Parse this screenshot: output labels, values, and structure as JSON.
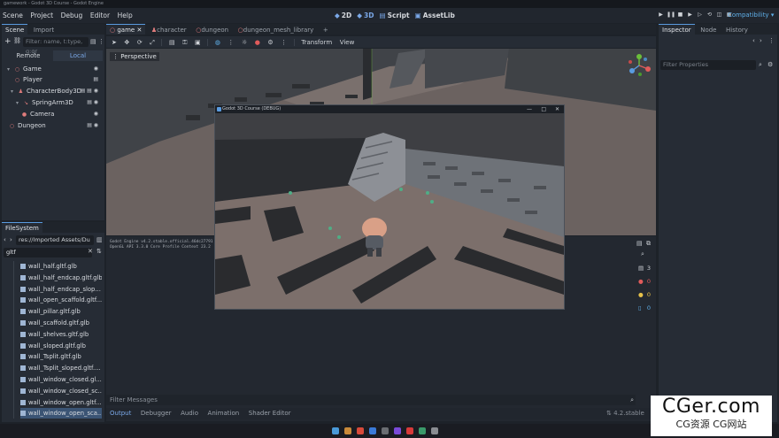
{
  "window_title": "gamework - Godot 3D Course - Godot Engine",
  "menu": [
    "Scene",
    "Project",
    "Debug",
    "Editor",
    "Help"
  ],
  "main_screens": [
    {
      "label": "2D",
      "icon": "2d-icon"
    },
    {
      "label": "3D",
      "icon": "3d-icon"
    },
    {
      "label": "Script",
      "icon": "script-icon"
    },
    {
      "label": "AssetLib",
      "icon": "assetlib-icon"
    }
  ],
  "renderer": "Compatibility",
  "scene_dock": {
    "tabs": [
      "Scene",
      "Import"
    ],
    "filter_placeholder": "Filter: name, t:type, g:gr",
    "remote_label": "Remote",
    "local_label": "Local",
    "nodes": [
      {
        "name": "Game",
        "icon": "node3d-icon",
        "color": "#e07c7c"
      },
      {
        "name": "Player",
        "icon": "node3d-icon",
        "color": "#e07c7c"
      },
      {
        "name": "CharacterBody3D",
        "icon": "characterbody-icon",
        "color": "#e07c7c"
      },
      {
        "name": "SpringArm3D",
        "icon": "springarm-icon",
        "color": "#e07c7c"
      },
      {
        "name": "Camera",
        "icon": "camera-icon",
        "color": "#e07c7c"
      },
      {
        "name": "Dungeon",
        "icon": "node3d-icon",
        "color": "#e07c7c"
      }
    ]
  },
  "filesystem_dock": {
    "tab": "FileSystem",
    "path": "res://Imported Assets/Du",
    "search_value": "gltf",
    "files": [
      "wall_half.gltf.glb",
      "wall_half_endcap.gltf.glb",
      "wall_half_endcap_slop...",
      "wall_open_scaffold.gltf...",
      "wall_pillar.gltf.glb",
      "wall_scaffold.gltf.glb",
      "wall_shelves.gltf.glb",
      "wall_sloped.gltf.glb",
      "wall_Tsplit.gltf.glb",
      "wall_Tsplit_sloped.gltf....",
      "wall_window_closed.gl...",
      "wall_window_closed_sc...",
      "wall_window_open.gltf....",
      "wall_window_open_sca..."
    ]
  },
  "scene_tabs": [
    "game",
    "character",
    "dungeon",
    "dungeon_mesh_library"
  ],
  "viewport": {
    "toolbar_menus": [
      "Transform",
      "View"
    ],
    "perspective_label": "Perspective"
  },
  "game_window": {
    "title": "Godot 3D Course (DEBUG)"
  },
  "output": {
    "lines": [
      "Godot Engine v4.2.stable.official.46dc27791 -",
      "OpenGL API 3.3.0 Core Profile Context 23.2"
    ],
    "filter_placeholder": "Filter Messages",
    "counts": {
      "errors": "3",
      "warnings": "0",
      "messages": "0",
      "other": "0"
    }
  },
  "bottom_tabs": [
    "Output",
    "Debugger",
    "Audio",
    "Animation",
    "Shader Editor"
  ],
  "version": "4.2.stable",
  "inspector": {
    "tabs": [
      "Inspector",
      "Node",
      "History"
    ],
    "filter_placeholder": "Filter Properties"
  },
  "watermark": {
    "line1": "CGer.com",
    "line2": "CG资源 CG网站"
  },
  "colors": {
    "accent": "#5a9be0",
    "error": "#e05b5b",
    "warning": "#e6c14a"
  }
}
